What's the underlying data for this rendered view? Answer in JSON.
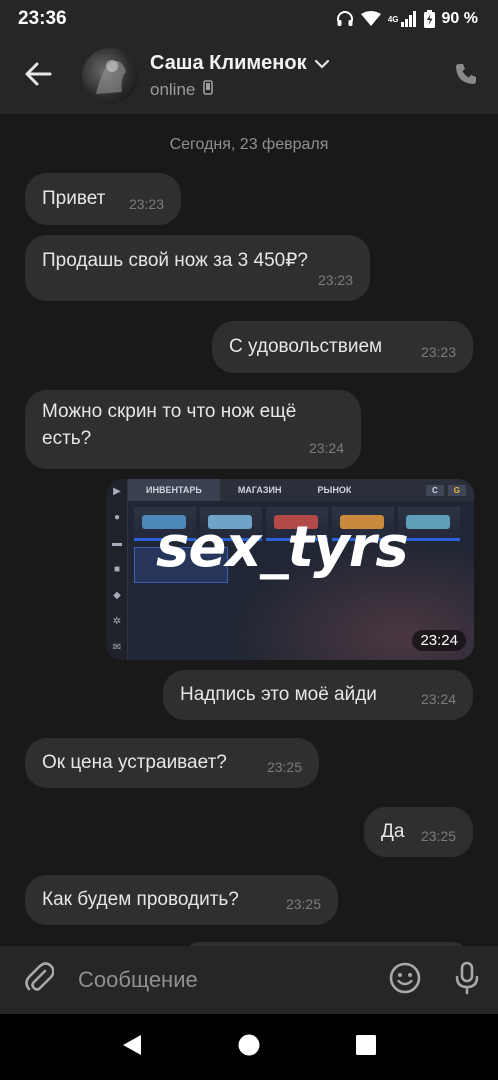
{
  "status_bar": {
    "time": "23:36",
    "network": "4G",
    "battery": "90 %",
    "icons": [
      "headphones-icon",
      "wifi-icon",
      "signal-icon",
      "battery-icon"
    ]
  },
  "header": {
    "name": "Саша Клименок",
    "status": "online",
    "icons": [
      "back-arrow-icon",
      "chevron-down-icon",
      "phone-icon",
      "mobile-icon"
    ]
  },
  "chat": {
    "date": "Сегодня, 23 февраля",
    "messages": [
      {
        "side": "in",
        "text": "Привет",
        "time": "23:23"
      },
      {
        "side": "in",
        "text": "Продашь свой нож за 3 450₽?",
        "time": "23:23"
      },
      {
        "side": "out",
        "text": "С удовольствием",
        "time": "23:23"
      },
      {
        "side": "in",
        "text": "Можно скрин то что нож ещё есть?",
        "time": "23:24"
      },
      {
        "side": "out",
        "type": "image",
        "time": "23:24"
      },
      {
        "side": "out",
        "text": "Надпись это моё айди",
        "time": "23:24"
      },
      {
        "side": "in",
        "text": "Ок цена устраивает?",
        "time": "23:25"
      },
      {
        "side": "out",
        "text": "Да",
        "time": "23:25"
      },
      {
        "side": "in",
        "text": "Как будем проводить?",
        "time": "23:25"
      }
    ],
    "image": {
      "overlay_text": "sex_tyrs",
      "tabs": [
        "ИНВЕНТАРЬ",
        "МАГАЗИН",
        "РЫНОК"
      ]
    }
  },
  "composer": {
    "placeholder": "Сообщение",
    "icons": [
      "paperclip-icon",
      "emoji-icon",
      "microphone-icon"
    ]
  },
  "navbar": {
    "icons": [
      "back-triangle-icon",
      "home-circle-icon",
      "recents-square-icon"
    ]
  },
  "colors": {
    "background": "#191919",
    "bar": "#262626",
    "bubble": "#2f2f2f",
    "text": "#e6e6e6",
    "muted": "#8e8e8e"
  }
}
